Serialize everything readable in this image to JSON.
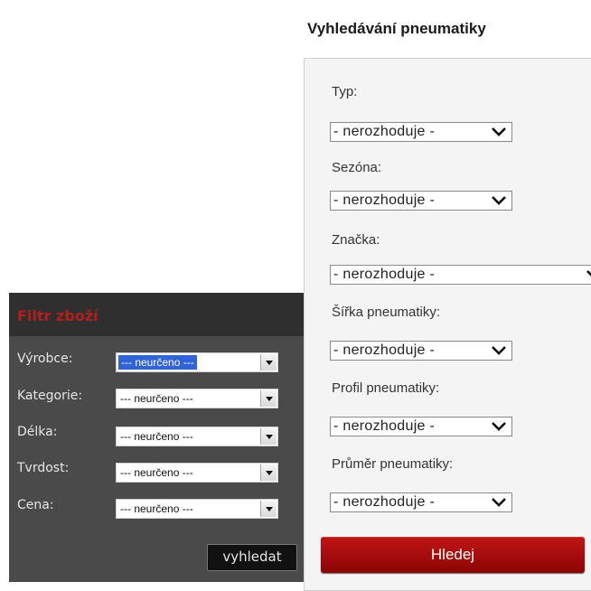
{
  "tyre_search": {
    "title": "Vyhledávání pneumatiky",
    "fields": [
      {
        "label": "Typ:",
        "value": "- nerozhoduje -"
      },
      {
        "label": "Sezóna:",
        "value": "- nerozhoduje -"
      },
      {
        "label": "Značka:",
        "value": "- nerozhoduje -"
      },
      {
        "label": "Šířka pneumatiky:",
        "value": "- nerozhoduje -"
      },
      {
        "label": "Profil pneumatiky:",
        "value": "- nerozhoduje -"
      },
      {
        "label": "Průměr pneumatiky:",
        "value": "- nerozhoduje -"
      }
    ],
    "button_label": "Hledej",
    "colors": {
      "button": "#a80a0a",
      "panel_bg": "#f4f4f4"
    }
  },
  "product_filter": {
    "title": "Filtr zboží",
    "fields": [
      {
        "label": "Výrobce:",
        "value": "--- neurčeno ---"
      },
      {
        "label": "Kategorie:",
        "value": "--- neurčeno ---"
      },
      {
        "label": "Délka:",
        "value": "--- neurčeno ---"
      },
      {
        "label": "Tvrdost:",
        "value": "--- neurčeno ---"
      },
      {
        "label": "Cena:",
        "value": "--- neurčeno ---"
      }
    ],
    "button_label": "vyhledat",
    "colors": {
      "title": "#b01e1e",
      "panel_bg": "#4a4a4a",
      "selection": "#2f63d6"
    }
  }
}
